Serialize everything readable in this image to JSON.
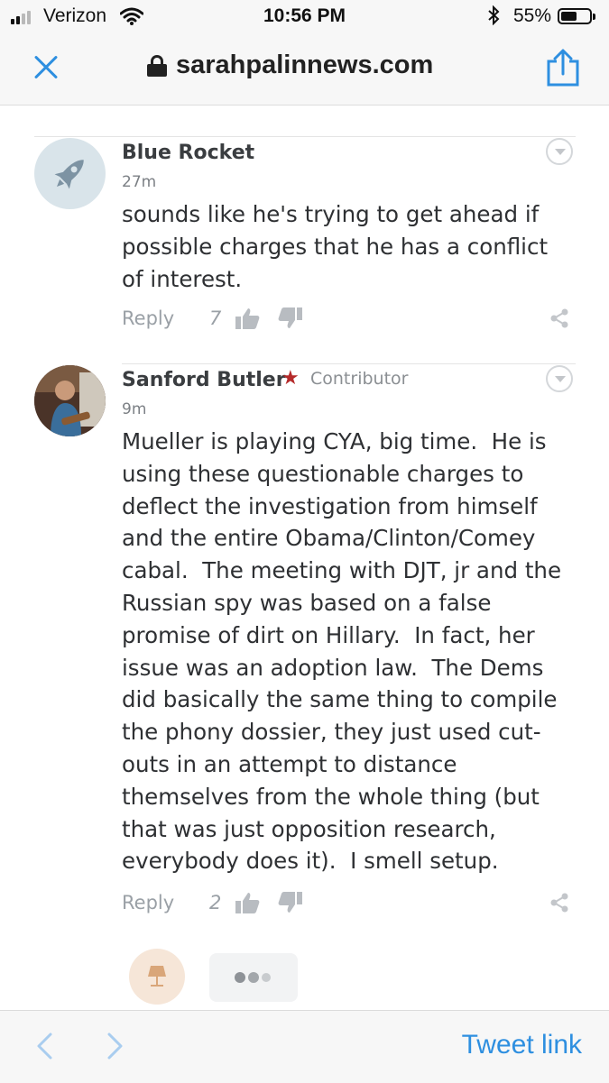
{
  "status_bar": {
    "carrier": "Verizon",
    "time": "10:56 PM",
    "battery_percent_label": "55%",
    "battery_level": 0.55
  },
  "browser": {
    "url": "sarahpalinnews.com",
    "close_icon": "close-icon",
    "lock_icon": "lock-icon",
    "share_icon": "share-icon"
  },
  "comments": [
    {
      "author": "Blue Rocket",
      "avatar_icon": "rocket-icon",
      "time": "27m",
      "body": "sounds like he's trying to get ahead if\npossible charges that he has a conflict\nof interest.",
      "reply_label": "Reply",
      "upvotes": "7"
    },
    {
      "author": "Sanford Butler",
      "badge": "Contributor",
      "badge_star": "★",
      "time": "9m",
      "body": "Mueller is playing CYA, big time.  He is\nusing these questionable charges to\ndeflect the investigation from himself\nand the entire Obama/Clinton/Comey\ncabal.  The meeting with DJT, jr and the\nRussian spy was based on a false\npromise of dirt on Hillary.  In fact, her\nissue was an adoption law.  The Dems\ndid basically the same thing to compile\nthe phony dossier, they just used cut-\nouts in an attempt to distance\nthemselves from the whole thing (but\nthat was just opposition research,\neverybody does it).  I smell setup.",
      "reply_label": "Reply",
      "upvotes": "2"
    }
  ],
  "bottom_toolbar": {
    "back_icon": "chevron-left-icon",
    "forward_icon": "chevron-right-icon",
    "tweet_link_label": "Tweet link"
  },
  "colors": {
    "accent_blue": "#2e8fe0",
    "contributor_star": "#b52a2a",
    "muted_gray": "#9aa0a6"
  }
}
